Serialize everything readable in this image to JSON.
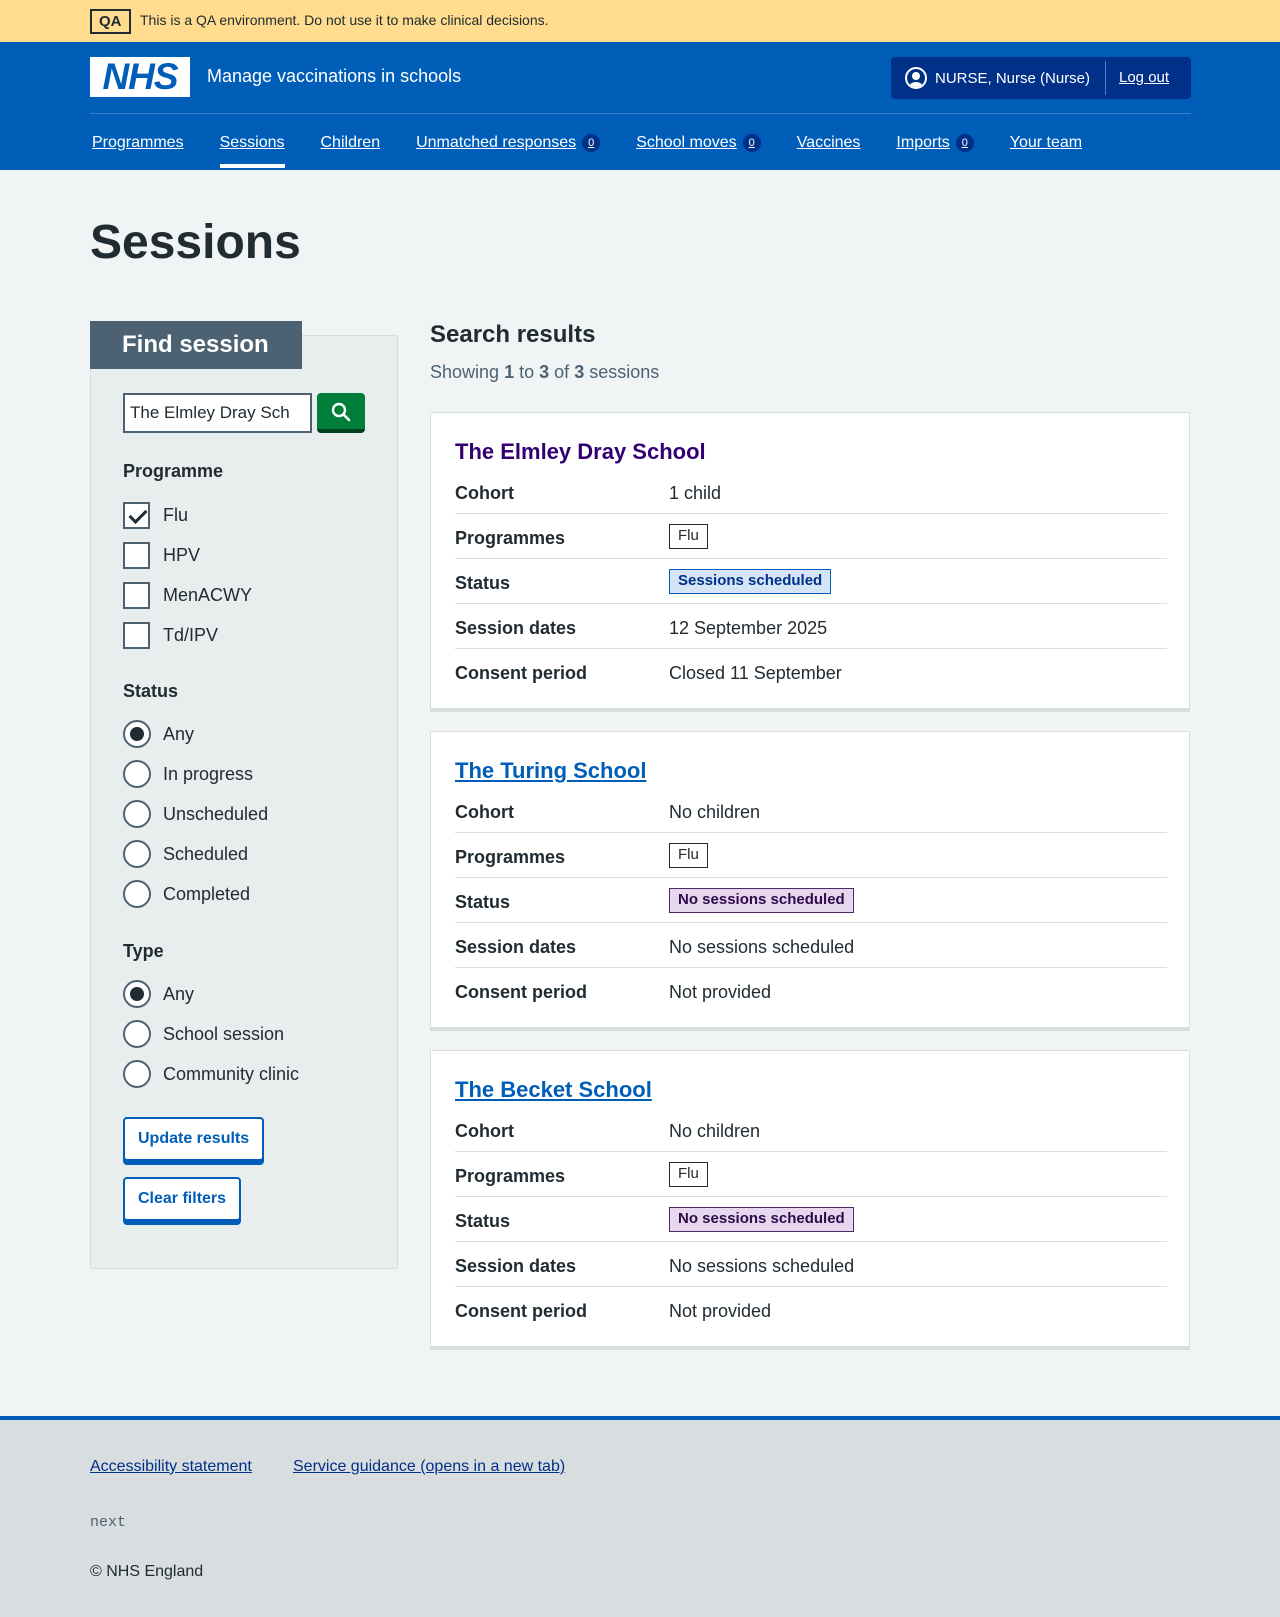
{
  "qa_banner": {
    "tag": "QA",
    "message": "This is a QA environment. Do not use it to make clinical decisions."
  },
  "header": {
    "logo": "NHS",
    "service_name": "Manage vaccinations in schools",
    "account_name": "NURSE, Nurse (Nurse)",
    "logout": "Log out"
  },
  "nav": [
    {
      "label": "Programmes"
    },
    {
      "label": "Sessions",
      "active": true
    },
    {
      "label": "Children"
    },
    {
      "label": "Unmatched responses",
      "count": "0"
    },
    {
      "label": "School moves",
      "count": "0"
    },
    {
      "label": "Vaccines"
    },
    {
      "label": "Imports",
      "count": "0"
    },
    {
      "label": "Your team"
    }
  ],
  "page_title": "Sessions",
  "filter": {
    "heading": "Find session",
    "search_value": "The Elmley Dray Sch",
    "programme_label": "Programme",
    "programmes": [
      {
        "label": "Flu",
        "checked": true
      },
      {
        "label": "HPV",
        "checked": false
      },
      {
        "label": "MenACWY",
        "checked": false
      },
      {
        "label": "Td/IPV",
        "checked": false
      }
    ],
    "status_label": "Status",
    "statuses": [
      {
        "label": "Any",
        "checked": true
      },
      {
        "label": "In progress",
        "checked": false
      },
      {
        "label": "Unscheduled",
        "checked": false
      },
      {
        "label": "Scheduled",
        "checked": false
      },
      {
        "label": "Completed",
        "checked": false
      }
    ],
    "type_label": "Type",
    "types": [
      {
        "label": "Any",
        "checked": true
      },
      {
        "label": "School session",
        "checked": false
      },
      {
        "label": "Community clinic",
        "checked": false
      }
    ],
    "update_button": "Update results",
    "clear_button": "Clear filters"
  },
  "results": {
    "title": "Search results",
    "showing_prefix": "Showing",
    "from": "1",
    "to_word": "to",
    "to": "3",
    "of_word": "of",
    "total": "3",
    "suffix": "sessions",
    "labels": {
      "cohort": "Cohort",
      "programmes": "Programmes",
      "status": "Status",
      "session_dates": "Session dates",
      "consent_period": "Consent period"
    },
    "sessions": [
      {
        "name": "The Elmley Dray School",
        "cohort": "1 child",
        "programme": "Flu",
        "status": "Sessions scheduled",
        "session_dates": "12 September 2025",
        "consent_period": "Closed 11 September"
      },
      {
        "name": "The Turing School",
        "cohort": "No children",
        "programme": "Flu",
        "status": "No sessions scheduled",
        "session_dates": "No sessions scheduled",
        "consent_period": "Not provided"
      },
      {
        "name": "The Becket School",
        "cohort": "No children",
        "programme": "Flu",
        "status": "No sessions scheduled",
        "session_dates": "No sessions scheduled",
        "consent_period": "Not provided"
      }
    ]
  },
  "footer": {
    "accessibility": "Accessibility statement",
    "guidance": "Service guidance (opens in a new tab)",
    "environment": "next",
    "copyright": "© NHS England"
  },
  "colors": {
    "nhs_blue": "#005eb8",
    "qa_yellow": "#ffdc8e",
    "green": "#007f3b",
    "filter_head": "#4c6272"
  }
}
